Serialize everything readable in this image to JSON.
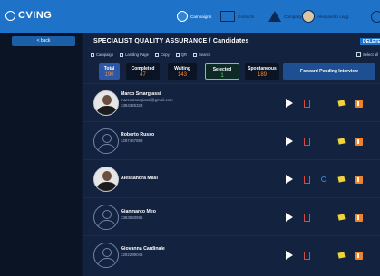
{
  "app": {
    "logo_text": "CVING"
  },
  "nav": {
    "campaigns": "Campaigns",
    "contacts": "Contacts",
    "company": "Company",
    "user": "Alessandro Legg"
  },
  "sidebar": {
    "back_label": "< back"
  },
  "main": {
    "title": "SPECIALIST QUALITY ASSURANCE / Candidates",
    "delete_label": "DELETE",
    "toolbar": [
      "Campaign",
      "Landing Page",
      "Copy",
      "QR",
      "Search"
    ],
    "select_all": "Select all",
    "stats": [
      {
        "label": "Total",
        "value": "190"
      },
      {
        "label": "Completed",
        "value": "47"
      },
      {
        "label": "Waiting",
        "value": "143"
      },
      {
        "label": "Selected",
        "value": "1"
      },
      {
        "label": "Spontaneous",
        "value": "189"
      }
    ],
    "forward_label": "Forward Pending Interview"
  },
  "candidates": [
    {
      "name": "Marco Smargiassi",
      "email": "marcosmargiassi@gmail.com",
      "phone": "3384325323",
      "photo": true
    },
    {
      "name": "Roberto Russo",
      "phone": "3287467889",
      "photo": false
    },
    {
      "name": "Alessandra Masi",
      "photo": true
    },
    {
      "name": "Gianmarco Meo",
      "phone": "3383583591",
      "photo": false
    },
    {
      "name": "Giovanna Cardinale",
      "phone": "3292299048",
      "photo": false
    }
  ],
  "colors": {
    "accent": "#1e73c8",
    "background": "#0f1a2e",
    "stat_highlight": "#ff8a2a",
    "selected": "#5ddc6d"
  }
}
